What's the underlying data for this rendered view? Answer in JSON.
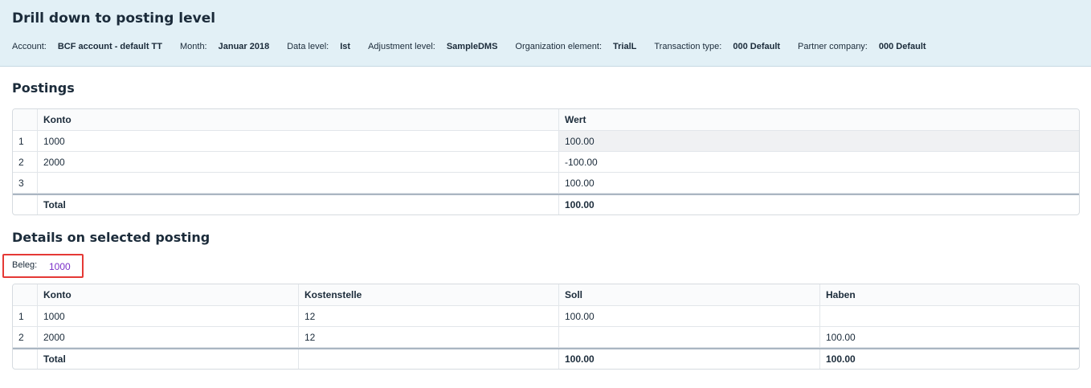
{
  "header": {
    "title": "Drill down to posting level",
    "meta": [
      {
        "label": "Account:",
        "value": "BCF account - default TT"
      },
      {
        "label": "Month:",
        "value": "Januar 2018"
      },
      {
        "label": "Data level:",
        "value": "Ist"
      },
      {
        "label": "Adjustment level:",
        "value": "SampleDMS"
      },
      {
        "label": "Organization element:",
        "value": "TrialL"
      },
      {
        "label": "Transaction type:",
        "value": "000 Default"
      },
      {
        "label": "Partner company:",
        "value": "000 Default"
      }
    ]
  },
  "postings": {
    "title": "Postings",
    "columns": [
      "Konto",
      "Wert"
    ],
    "rows": [
      {
        "idx": "1",
        "konto": "1000",
        "wert": "100.00",
        "selected": true
      },
      {
        "idx": "2",
        "konto": "2000",
        "wert": "-100.00"
      },
      {
        "idx": "3",
        "konto": "",
        "wert": "100.00"
      }
    ],
    "total": {
      "label": "Total",
      "wert": "100.00"
    }
  },
  "details": {
    "title": "Details on selected posting",
    "beleg_label": "Beleg:",
    "beleg_value": "1000",
    "columns": [
      "Konto",
      "Kostenstelle",
      "Soll",
      "Haben"
    ],
    "rows": [
      {
        "idx": "1",
        "konto": "1000",
        "kostenstelle": "12",
        "soll": "100.00",
        "haben": ""
      },
      {
        "idx": "2",
        "konto": "2000",
        "kostenstelle": "12",
        "soll": "",
        "haben": "100.00"
      }
    ],
    "total": {
      "label": "Total",
      "kostenstelle": "",
      "soll": "100.00",
      "haben": "100.00"
    }
  },
  "colors": {
    "header_bg": "#e2f0f6",
    "highlight_border": "#e53935",
    "link": "#7b2fc9"
  }
}
